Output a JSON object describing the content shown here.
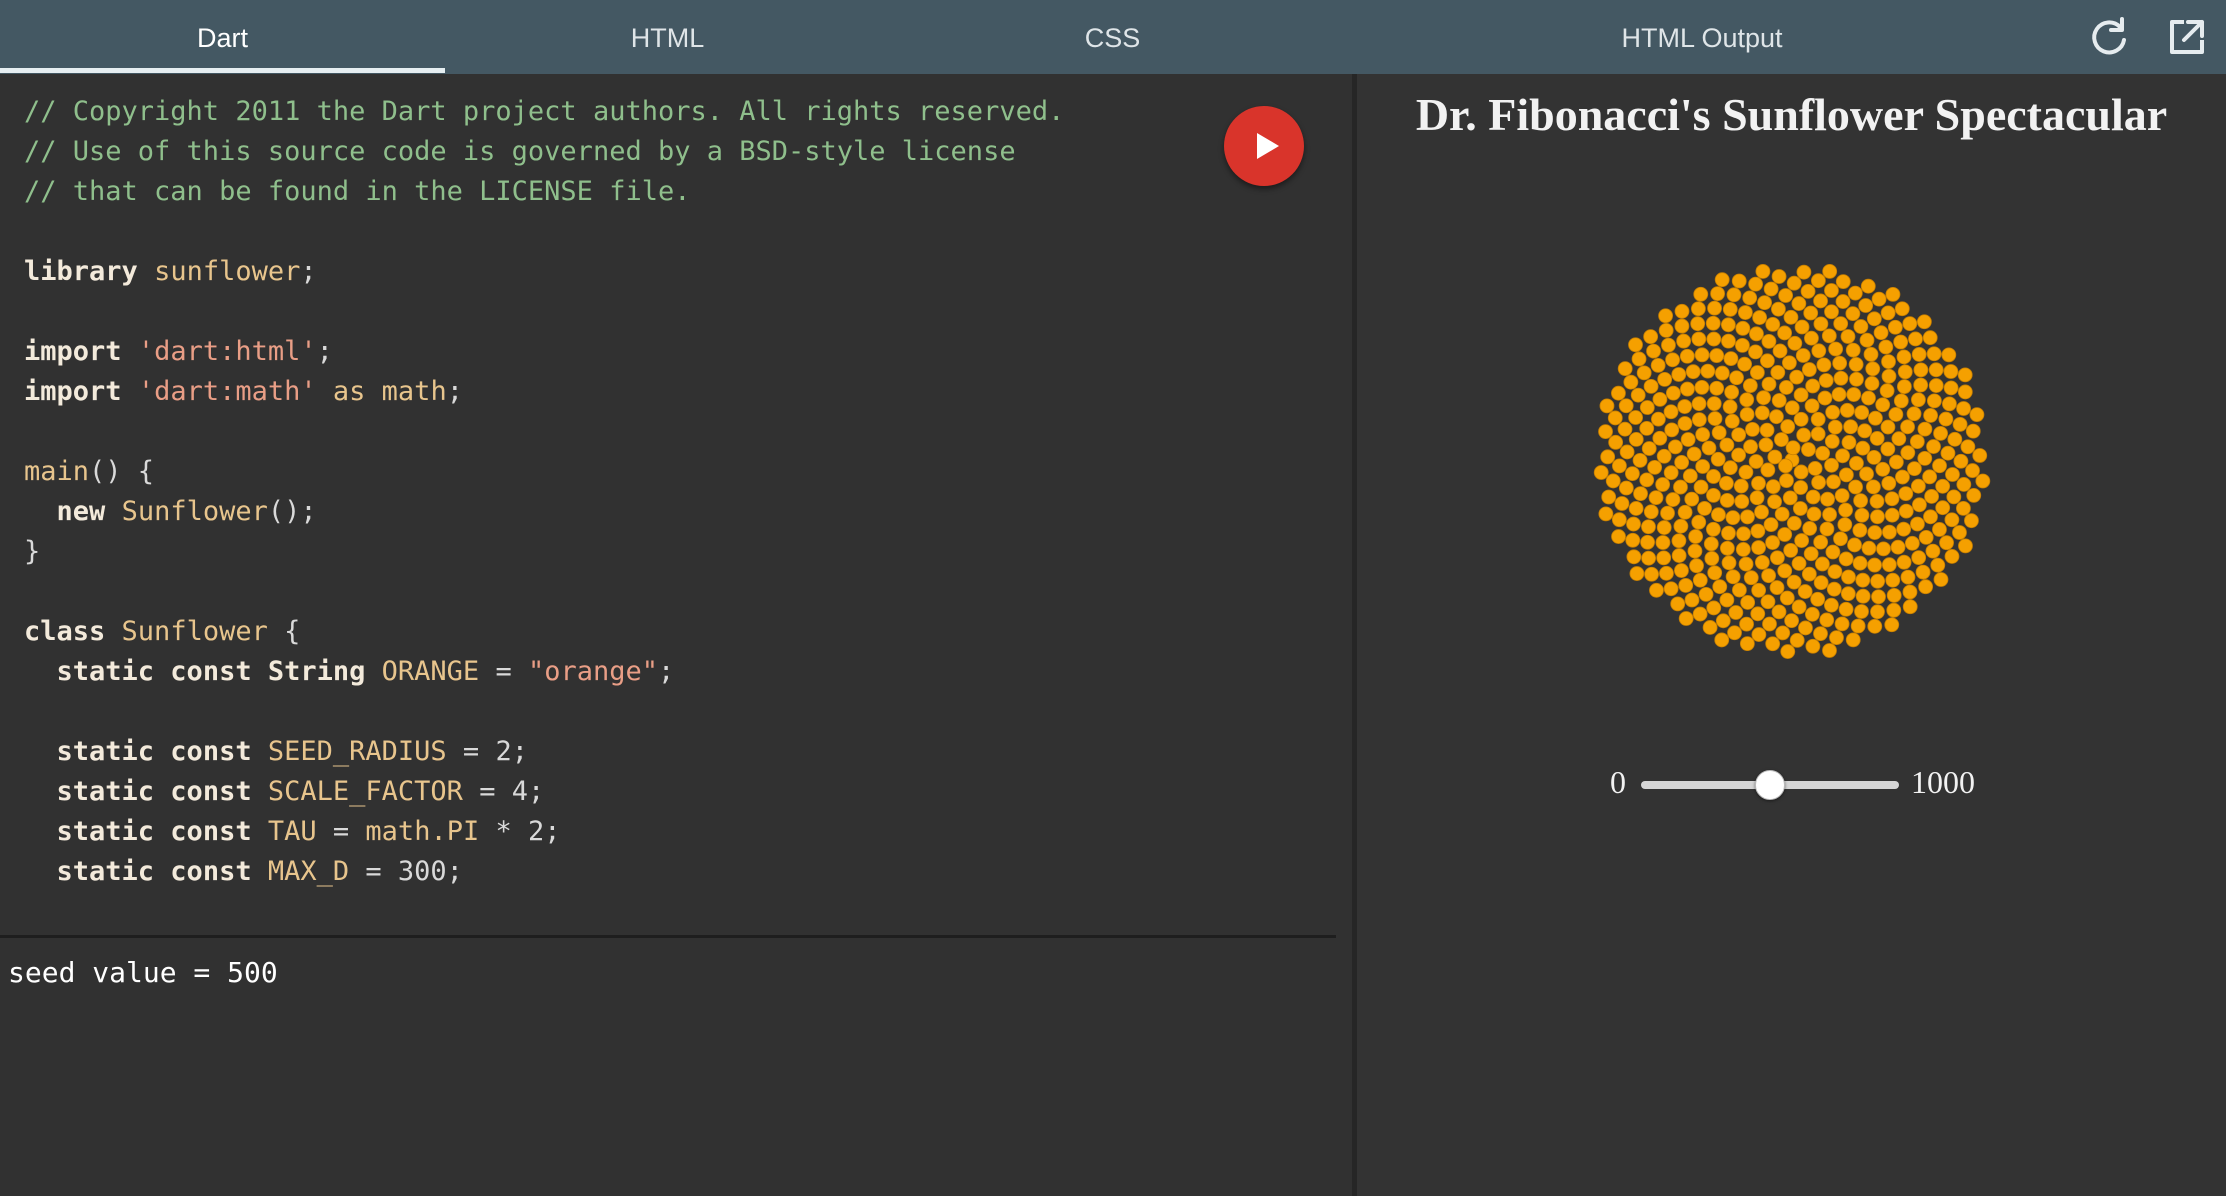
{
  "tabs": [
    {
      "label": "Dart",
      "active": true
    },
    {
      "label": "HTML",
      "active": false
    },
    {
      "label": "CSS",
      "active": false
    },
    {
      "label": "HTML Output",
      "active": false
    }
  ],
  "toolbar": {
    "refresh_icon": "refresh-icon",
    "popout_icon": "external-link-icon"
  },
  "run_button": {
    "icon": "play-icon",
    "color": "#d9342b"
  },
  "code": {
    "lines": [
      [
        [
          "com",
          "// Copyright 2011 the Dart project authors. All rights reserved."
        ]
      ],
      [
        [
          "com",
          "// Use of this source code is governed by a BSD-style license"
        ]
      ],
      [
        [
          "com",
          "// that can be found in the LICENSE file."
        ]
      ],
      [],
      [
        [
          "kw",
          "library"
        ],
        [
          "txt",
          " "
        ],
        [
          "id",
          "sunflower"
        ],
        [
          "txt",
          ";"
        ]
      ],
      [],
      [
        [
          "kw",
          "import"
        ],
        [
          "txt",
          " "
        ],
        [
          "str",
          "'dart:html'"
        ],
        [
          "txt",
          ";"
        ]
      ],
      [
        [
          "kw",
          "import"
        ],
        [
          "txt",
          " "
        ],
        [
          "str",
          "'dart:math'"
        ],
        [
          "txt",
          " "
        ],
        [
          "id",
          "as"
        ],
        [
          "txt",
          " "
        ],
        [
          "id",
          "math"
        ],
        [
          "txt",
          ";"
        ]
      ],
      [],
      [
        [
          "id",
          "main"
        ],
        [
          "txt",
          "() {"
        ]
      ],
      [
        [
          "txt",
          "  "
        ],
        [
          "kw",
          "new"
        ],
        [
          "txt",
          " "
        ],
        [
          "id",
          "Sunflower"
        ],
        [
          "txt",
          "();"
        ]
      ],
      [
        [
          "txt",
          "}"
        ]
      ],
      [],
      [
        [
          "kw",
          "class"
        ],
        [
          "txt",
          " "
        ],
        [
          "id",
          "Sunflower"
        ],
        [
          "txt",
          " {"
        ]
      ],
      [
        [
          "txt",
          "  "
        ],
        [
          "kw",
          "static const String"
        ],
        [
          "txt",
          " "
        ],
        [
          "id",
          "ORANGE"
        ],
        [
          "txt",
          " = "
        ],
        [
          "str",
          "\"orange\""
        ],
        [
          "txt",
          ";"
        ]
      ],
      [],
      [
        [
          "txt",
          "  "
        ],
        [
          "kw",
          "static const"
        ],
        [
          "txt",
          " "
        ],
        [
          "id",
          "SEED_RADIUS"
        ],
        [
          "txt",
          " = 2;"
        ]
      ],
      [
        [
          "txt",
          "  "
        ],
        [
          "kw",
          "static const"
        ],
        [
          "txt",
          " "
        ],
        [
          "id",
          "SCALE_FACTOR"
        ],
        [
          "txt",
          " = 4;"
        ]
      ],
      [
        [
          "txt",
          "  "
        ],
        [
          "kw",
          "static const"
        ],
        [
          "txt",
          " "
        ],
        [
          "id",
          "TAU"
        ],
        [
          "txt",
          " = "
        ],
        [
          "id",
          "math.PI"
        ],
        [
          "txt",
          " * 2;"
        ]
      ],
      [
        [
          "txt",
          "  "
        ],
        [
          "kw",
          "static const"
        ],
        [
          "txt",
          " "
        ],
        [
          "id",
          "MAX_D"
        ],
        [
          "txt",
          " = 300;"
        ]
      ]
    ]
  },
  "console": {
    "output": "seed value = 500"
  },
  "output": {
    "title": "Dr. Fibonacci's Sunflower Spectacular",
    "seed_color": "#f5a000",
    "seeds": 500,
    "slider": {
      "min_label": "0",
      "max_label": "1000",
      "min": 0,
      "max": 1000,
      "value": 500
    }
  }
}
